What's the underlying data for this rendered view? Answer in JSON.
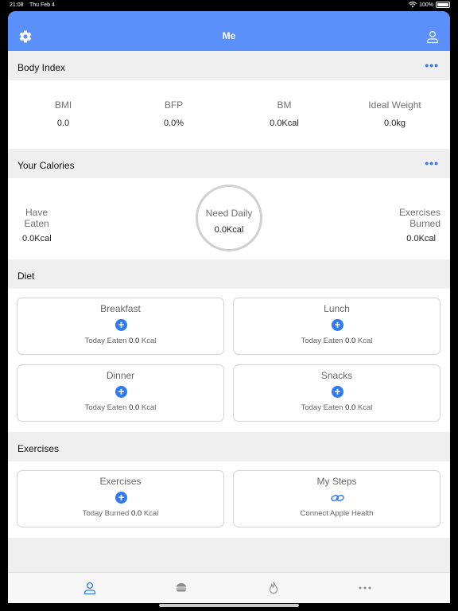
{
  "status_bar": {
    "time": "21:08",
    "date": "Thu Feb 4",
    "battery": "100%",
    "battery_level": 1.0
  },
  "header": {
    "title": "Me",
    "settings_icon": "gear-icon",
    "profile_icon": "person-icon"
  },
  "body_index": {
    "title": "Body Index",
    "more_label": "•••",
    "items": [
      {
        "label": "BMI",
        "value": "0.0"
      },
      {
        "label": "BFP",
        "value": "0.0%"
      },
      {
        "label": "BM",
        "value": "0.0Kcal"
      },
      {
        "label": "Ideal Weight",
        "value": "0.0kg"
      }
    ]
  },
  "calories": {
    "title": "Your Calories",
    "more_label": "•••",
    "eaten": {
      "line1": "Have",
      "line2": "Eaten",
      "value": "0.0Kcal"
    },
    "need": {
      "label": "Need Daily",
      "value": "0.0Kcal"
    },
    "burned": {
      "line1": "Exercises",
      "line2": "Burned",
      "value": "0.0Kcal"
    }
  },
  "diet": {
    "title": "Diet",
    "cards": [
      {
        "name": "Breakfast",
        "prefix": "Today Eaten",
        "value": "0.0",
        "unit": "Kcal"
      },
      {
        "name": "Lunch",
        "prefix": "Today Eaten",
        "value": "0.0",
        "unit": "Kcal"
      },
      {
        "name": "Dinner",
        "prefix": "Today Eaten",
        "value": "0.0",
        "unit": "Kcal"
      },
      {
        "name": "Snacks",
        "prefix": "Today Eaten",
        "value": "0.0",
        "unit": "Kcal"
      }
    ]
  },
  "exercises": {
    "title": "Exercises",
    "exercise_card": {
      "name": "Exercises",
      "prefix": "Today Burned",
      "value": "0.0",
      "unit": "Kcal"
    },
    "steps_card": {
      "name": "My Steps",
      "sub": "Connect Apple Health"
    }
  },
  "plus_label": "+",
  "tabs": [
    {
      "icon": "person-icon",
      "active": true
    },
    {
      "icon": "burger-icon",
      "active": false
    },
    {
      "icon": "flame-icon",
      "active": false
    },
    {
      "icon": "more-icon",
      "active": false
    }
  ],
  "colors": {
    "accent": "#5b8ff9",
    "button_blue": "#2f7bf5",
    "background": "#efefef"
  }
}
